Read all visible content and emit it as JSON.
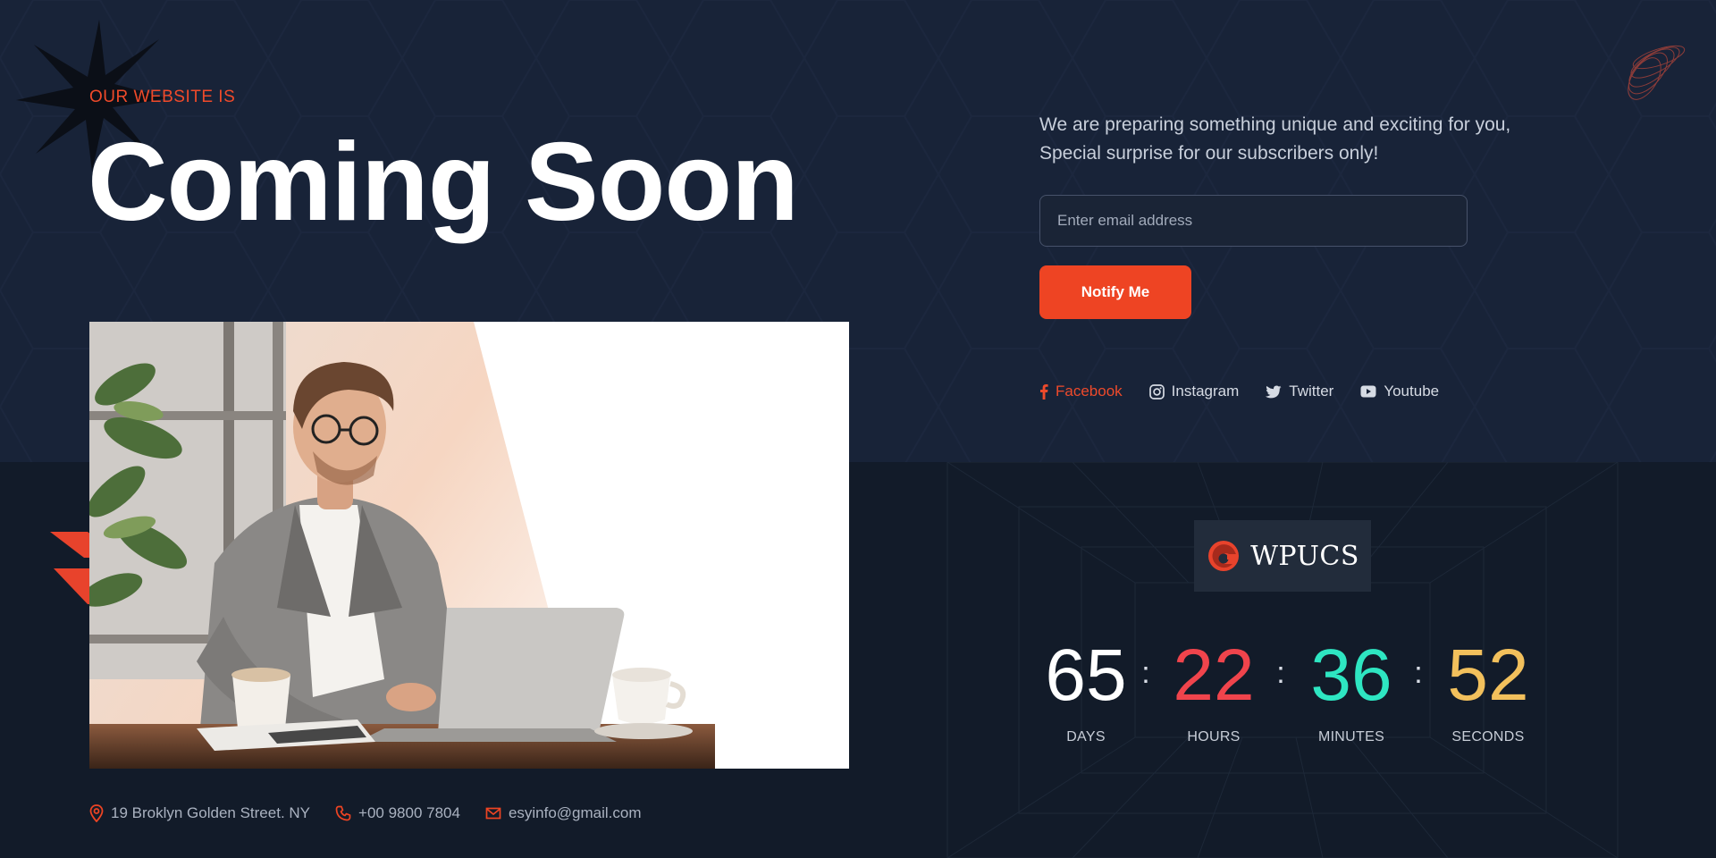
{
  "heading": {
    "eyebrow": "OUR WEBSITE IS",
    "title": "Coming Soon"
  },
  "subscribe": {
    "intro": "We are preparing something unique and exciting for you, Special surprise for our subscribers only!",
    "email_placeholder": "Enter email address",
    "button_label": "Notify Me"
  },
  "socials": [
    {
      "label": "Facebook",
      "icon": "facebook-icon",
      "active": true
    },
    {
      "label": "Instagram",
      "icon": "instagram-icon",
      "active": false
    },
    {
      "label": "Twitter",
      "icon": "twitter-icon",
      "active": false
    },
    {
      "label": "Youtube",
      "icon": "youtube-icon",
      "active": false
    }
  ],
  "logo": {
    "text": "WPUCS"
  },
  "countdown": {
    "separator": ":",
    "units": [
      {
        "value": "65",
        "label": "DAYS",
        "color": "#ffffff"
      },
      {
        "value": "22",
        "label": "HOURS",
        "color": "#f0444c"
      },
      {
        "value": "36",
        "label": "MINUTES",
        "color": "#2ee6c2"
      },
      {
        "value": "52",
        "label": "SECONDS",
        "color": "#f2c05c"
      }
    ]
  },
  "contacts": {
    "address": "19 Broklyn Golden Street. NY",
    "phone": "+00 9800 7804",
    "email": "esyinfo@gmail.com"
  },
  "colors": {
    "accent": "#ee4423",
    "top_background": "#182338",
    "bottom_background": "#121b29"
  }
}
